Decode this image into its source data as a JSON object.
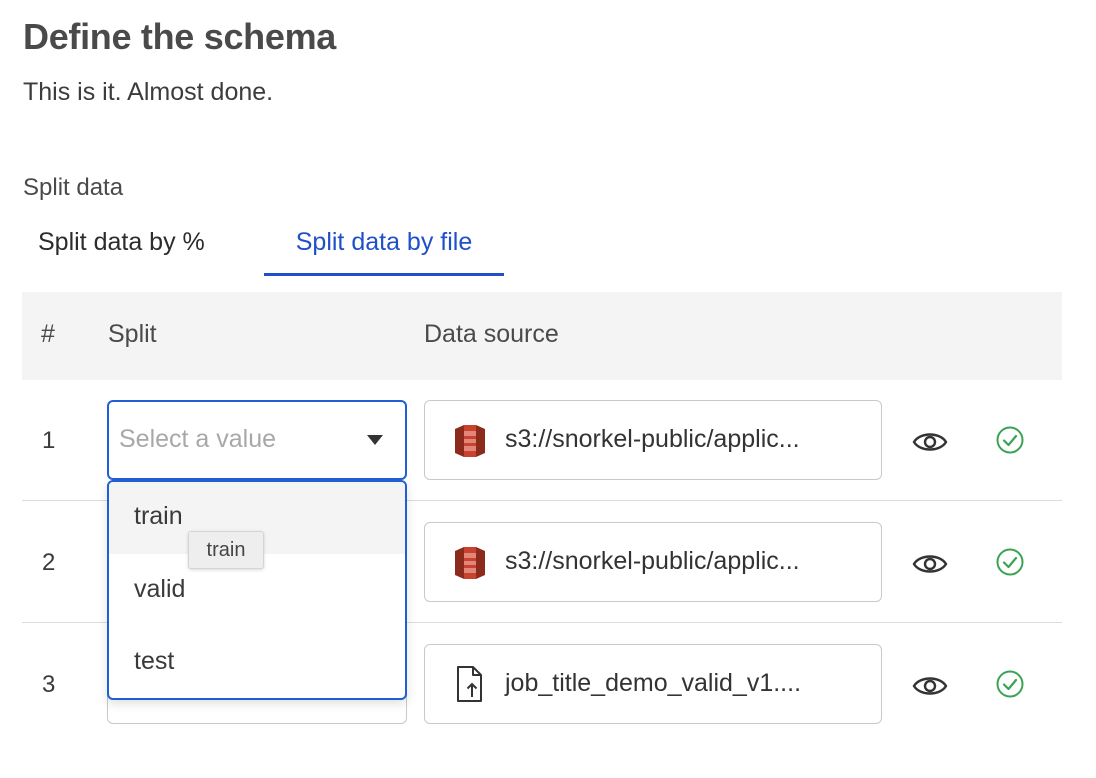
{
  "page": {
    "title": "Define the schema",
    "subtitle": "This is it. Almost done."
  },
  "split_section": {
    "label": "Split data",
    "tabs": [
      {
        "label": "Split data by %",
        "active": false
      },
      {
        "label": "Split data by file",
        "active": true
      }
    ]
  },
  "table": {
    "headers": {
      "num": "#",
      "split": "Split",
      "source": "Data source"
    },
    "rows": [
      {
        "num": "1",
        "split_placeholder": "Select a value",
        "source": "s3://snorkel-public/applic...",
        "source_type": "s3-bucket-icon",
        "status": "success"
      },
      {
        "num": "2",
        "split_placeholder": "",
        "source": "s3://snorkel-public/applic...",
        "source_type": "s3-bucket-icon",
        "status": "success"
      },
      {
        "num": "3",
        "split_placeholder": "",
        "source": "job_title_demo_valid_v1....",
        "source_type": "file-upload-icon",
        "status": "success"
      }
    ]
  },
  "dropdown": {
    "options": [
      "train",
      "valid",
      "test"
    ],
    "hovered": "train",
    "tooltip": "train"
  },
  "colors": {
    "accent": "#1f4fc9",
    "focus_border": "#1f5fd6",
    "success": "#3aa353",
    "s3_red": "#c7432e",
    "header_bg": "#f4f4f4"
  }
}
